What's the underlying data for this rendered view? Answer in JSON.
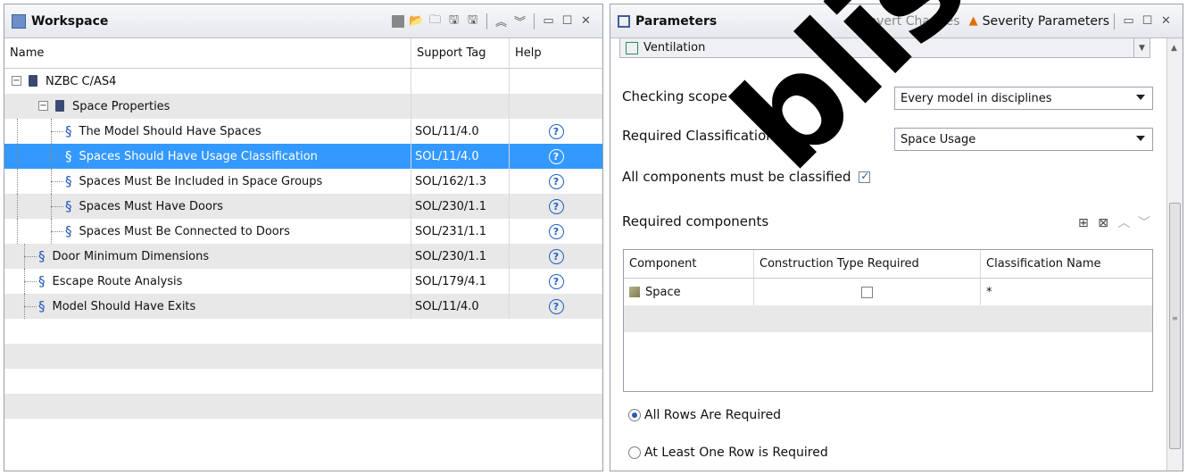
{
  "workspace": {
    "title": "Workspace",
    "columns": {
      "name": "Name",
      "support_tag": "Support Tag",
      "help": "Help"
    },
    "rows": [
      {
        "name": "NZBC C/AS4",
        "tag": "",
        "help": "",
        "level": 0,
        "kind": "root"
      },
      {
        "name": "Space Properties",
        "tag": "",
        "help": "",
        "level": 1,
        "kind": "folder"
      },
      {
        "name": "The Model Should Have Spaces",
        "tag": "SOL/11/4.0",
        "help": "?",
        "level": 2,
        "kind": "rule"
      },
      {
        "name": "Spaces Should Have Usage Classification",
        "tag": "SOL/11/4.0",
        "help": "?",
        "level": 2,
        "kind": "rule",
        "selected": true
      },
      {
        "name": "Spaces Must Be Included in Space Groups",
        "tag": "SOL/162/1.3",
        "help": "?",
        "level": 2,
        "kind": "rule"
      },
      {
        "name": "Spaces Must Have Doors",
        "tag": "SOL/230/1.1",
        "help": "?",
        "level": 2,
        "kind": "rule"
      },
      {
        "name": "Spaces Must Be Connected to Doors",
        "tag": "SOL/231/1.1",
        "help": "?",
        "level": 2,
        "kind": "rule"
      },
      {
        "name": "Door Minimum Dimensions",
        "tag": "SOL/230/1.1",
        "help": "?",
        "level": 1,
        "kind": "rule"
      },
      {
        "name": "Escape Route Analysis",
        "tag": "SOL/179/4.1",
        "help": "?",
        "level": 1,
        "kind": "rule"
      },
      {
        "name": "Model Should Have Exits",
        "tag": "SOL/11/4.0",
        "help": "?",
        "level": 1,
        "kind": "rule"
      }
    ]
  },
  "parameters": {
    "title": "Parameters",
    "revert_label": "Revert Changes",
    "severity_label": "Severity Parameters",
    "ventilation": "Ventilation",
    "checking_scope_label": "Checking scope",
    "checking_scope_value": "Every model in disciplines",
    "required_classification_label": "Required Classification",
    "required_classification_value": "Space Usage",
    "all_classified_label": "All components must be classified",
    "required_components_label": "Required components",
    "table": {
      "headers": [
        "Component",
        "Construction Type Required",
        "Classification Name"
      ],
      "rows": [
        {
          "component": "Space",
          "classification": "*"
        }
      ]
    },
    "radio_all": "All Rows Are Required",
    "radio_one": "At Least One Row is Required"
  },
  "watermark": "blished"
}
